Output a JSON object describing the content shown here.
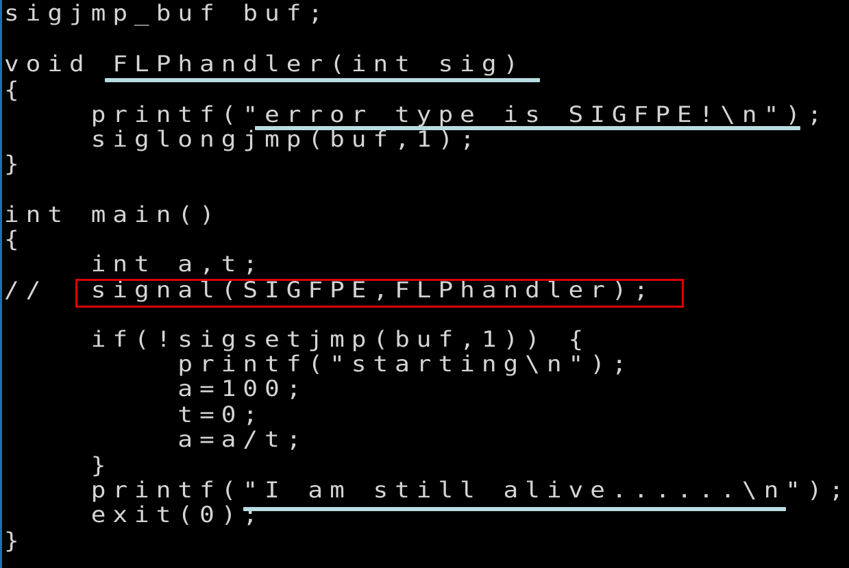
{
  "code": {
    "lines": [
      "sigjmp_buf buf;",
      "void FLPhandler(int sig)",
      "{",
      "    printf(\"error type is SIGFPE!\\n\");",
      "    siglongjmp(buf,1);",
      "}",
      "int main()",
      "{",
      "    int a,t;",
      "//  signal(SIGFPE,FLPhandler);",
      "    if(!sigsetjmp(buf,1)) {",
      "        printf(\"starting\\n\");",
      "        a=100;",
      "        t=0;",
      "        a=a/t;",
      "    }",
      "    printf(\"I am still alive......\\n\");",
      "    exit(0);",
      "}"
    ]
  },
  "annotations": {
    "underline_color": "#b7dde1",
    "highlight_box_color": "#e00000",
    "underlined": [
      "FLPhandler(int sig)",
      "\"error type is SIGFPE!\\n\"",
      "\"I am still alive......\\n\""
    ],
    "boxed": "signal(SIGFPE,FLPhandler);"
  },
  "colors": {
    "background": "#000000",
    "text": "#d4d4d4",
    "window_edge": "#1a6fc0"
  }
}
